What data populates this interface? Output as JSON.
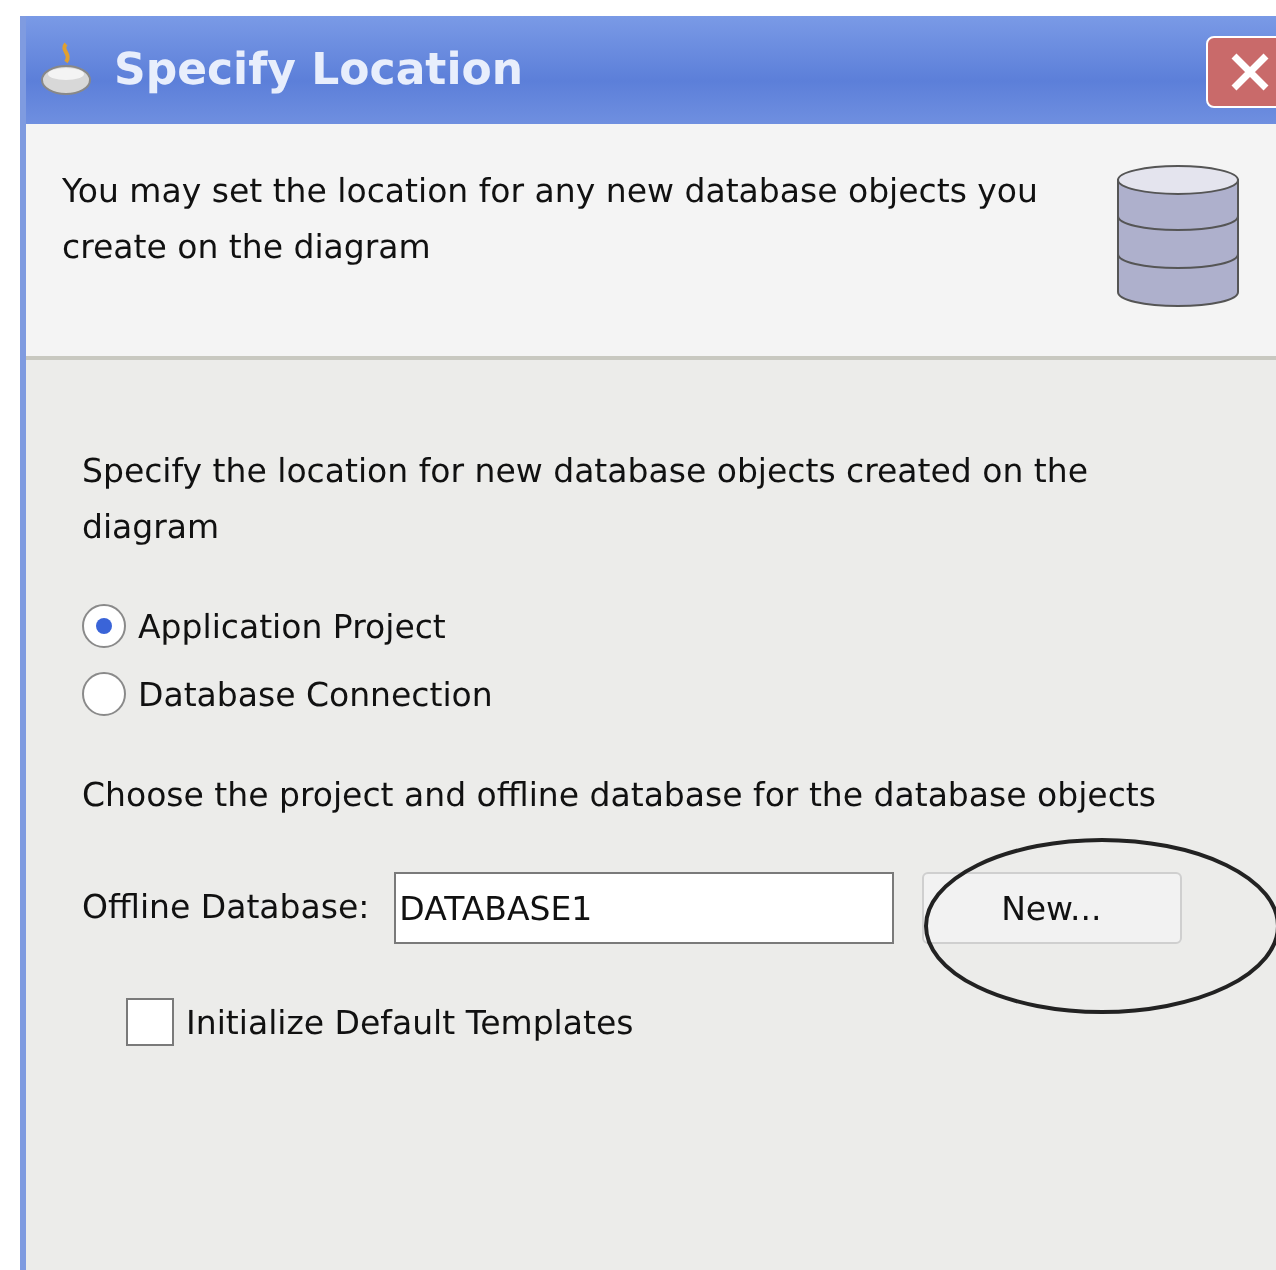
{
  "window": {
    "title": "Specify Location"
  },
  "header": {
    "description": "You may set the location for any new database objects you create on the diagram"
  },
  "location": {
    "prompt": "Specify the location for new database objects created on the diagram",
    "options": [
      {
        "label": "Application Project",
        "selected": true
      },
      {
        "label": "Database Connection",
        "selected": false
      }
    ]
  },
  "project": {
    "prompt": "Choose the project and offline database for the database objects",
    "offline_database": {
      "label": "Offline Database:",
      "value": "DATABASE1"
    },
    "new_button": "New...",
    "highlighted": true
  },
  "templates": {
    "label": "Initialize Default Templates",
    "checked": false
  }
}
